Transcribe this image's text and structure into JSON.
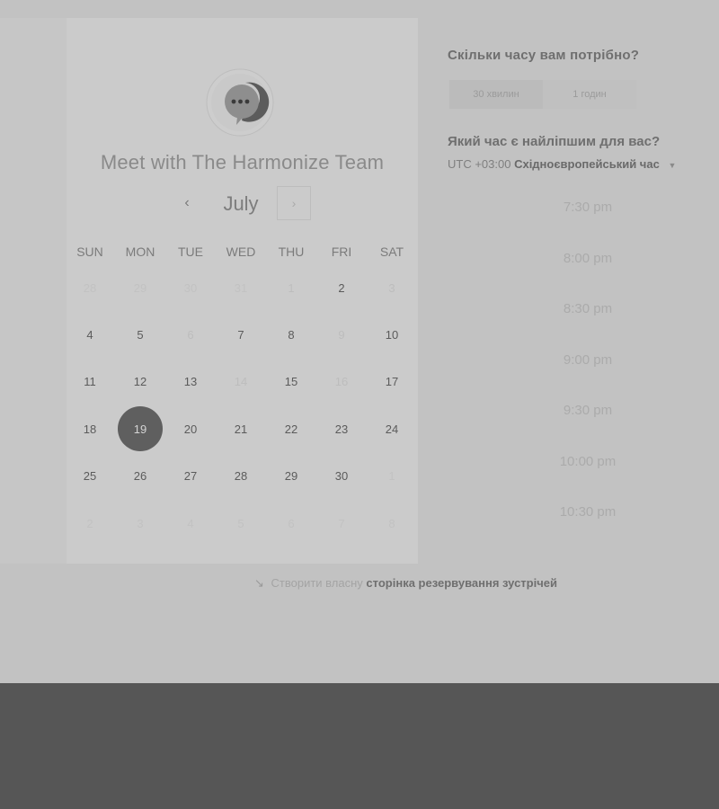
{
  "booking": {
    "title": "Meet with The Harmonize Team",
    "month": "July",
    "prev_icon": "‹",
    "next_icon": "›"
  },
  "calendar": {
    "weekdays": [
      "SUN",
      "MON",
      "TUE",
      "WED",
      "THU",
      "FRI",
      "SAT"
    ],
    "weeks": [
      [
        "28",
        "29",
        "30",
        "31",
        "1",
        "2",
        "3"
      ],
      [
        "4",
        "5",
        "6",
        "7",
        "8",
        "9",
        "10"
      ],
      [
        "11",
        "12",
        "13",
        "14",
        "15",
        "16",
        "17"
      ],
      [
        "18",
        "19",
        "20",
        "21",
        "22",
        "23",
        "24"
      ],
      [
        "25",
        "26",
        "27",
        "28",
        "29",
        "30",
        "1"
      ],
      [
        "2",
        "3",
        "4",
        "5",
        "6",
        "7",
        "8"
      ]
    ],
    "states": [
      [
        "out",
        "out",
        "out",
        "out",
        "na",
        "av",
        "na"
      ],
      [
        "av",
        "av",
        "na",
        "av",
        "av",
        "na",
        "av"
      ],
      [
        "av",
        "av",
        "av",
        "na",
        "av",
        "na",
        "av"
      ],
      [
        "av",
        "sel",
        "av",
        "av",
        "av",
        "av",
        "av"
      ],
      [
        "av",
        "av",
        "av",
        "av",
        "av",
        "av",
        "out"
      ],
      [
        "out",
        "out",
        "out",
        "out",
        "out",
        "out",
        "out"
      ]
    ],
    "selected_day": "19"
  },
  "duration": {
    "question": "Скільки часу вам потрібно?",
    "options": [
      "30 хвилин",
      "1 годин"
    ]
  },
  "time": {
    "question": "Який час є найліпшим для вас?",
    "timezone_offset": "UTC +03:00",
    "timezone_name": "Східноєвропейський час",
    "caret_icon": "▼",
    "slots": [
      "7:30 pm",
      "8:00 pm",
      "8:30 pm",
      "9:00 pm",
      "9:30 pm",
      "10:00 pm",
      "10:30 pm"
    ]
  },
  "footer": {
    "icon": "↘",
    "prefix": "Створити власну",
    "link": "сторінка резервування зустрічей"
  },
  "colors": {
    "selected_day_bg": "#5f5f5f",
    "overlay_bg": "#c2c2c2",
    "bottom_bar": "#565656"
  }
}
